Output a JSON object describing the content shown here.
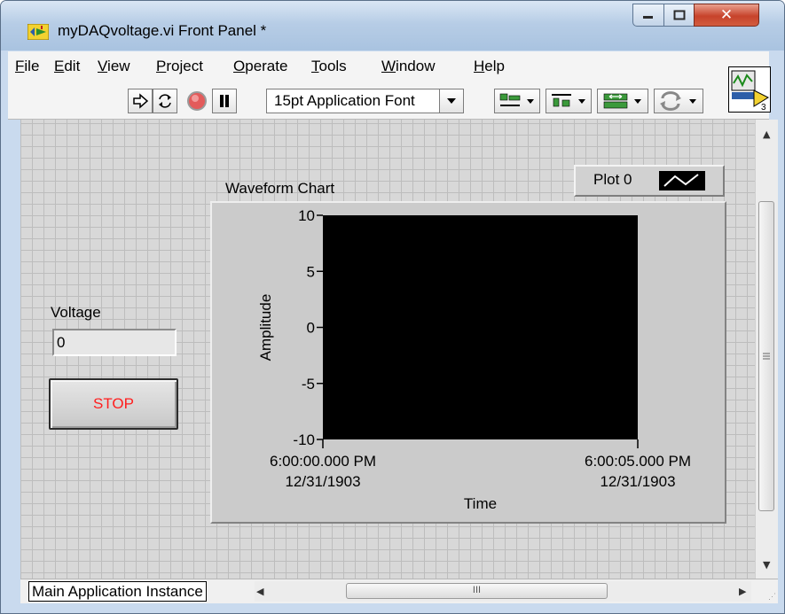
{
  "window": {
    "title": "myDAQvoltage.vi Front Panel *",
    "controls": {
      "minimize_icon": "minimize-icon",
      "maximize_icon": "maximize-icon",
      "close_icon": "close-icon"
    }
  },
  "menu": {
    "items": [
      {
        "label": "File",
        "mnemonic": "F",
        "rest": "ile"
      },
      {
        "label": "Edit",
        "mnemonic": "E",
        "rest": "dit"
      },
      {
        "label": "View",
        "mnemonic": "V",
        "rest": "iew"
      },
      {
        "label": "Project",
        "mnemonic": "P",
        "rest": "roject"
      },
      {
        "label": "Operate",
        "mnemonic": "O",
        "rest": "perate"
      },
      {
        "label": "Tools",
        "mnemonic": "T",
        "rest": "ools"
      },
      {
        "label": "Window",
        "mnemonic": "W",
        "rest": "indow"
      },
      {
        "label": "Help",
        "mnemonic": "H",
        "rest": "elp"
      }
    ]
  },
  "toolbar": {
    "font_selector": "15pt Application Font",
    "icons": [
      "run-arrow-icon",
      "run-continuously-icon",
      "abort-icon",
      "pause-icon",
      "align-objects-icon",
      "distribute-objects-icon",
      "resize-objects-icon",
      "reorder-icon"
    ]
  },
  "front_panel": {
    "voltage": {
      "label": "Voltage",
      "value": "0"
    },
    "stop_button": {
      "label": "STOP",
      "text_color": "#ff1e1e"
    },
    "chart_legend": {
      "plot_name": "Plot 0"
    }
  },
  "chart_data": {
    "type": "line",
    "title": "Waveform Chart",
    "xlabel": "Time",
    "ylabel": "Amplitude",
    "ylim": [
      -10,
      10
    ],
    "yticks": [
      10,
      5,
      0,
      -5,
      -10
    ],
    "xticks": [
      {
        "time": "6:00:00.000 PM",
        "date": "12/31/1903"
      },
      {
        "time": "6:00:05.000 PM",
        "date": "12/31/1903"
      }
    ],
    "series": [
      {
        "name": "Plot 0",
        "values": []
      }
    ],
    "plot_background": "#000000",
    "grid": false
  },
  "statusbar": {
    "instance": "Main Application Instance",
    "scroll_grip": "III"
  }
}
